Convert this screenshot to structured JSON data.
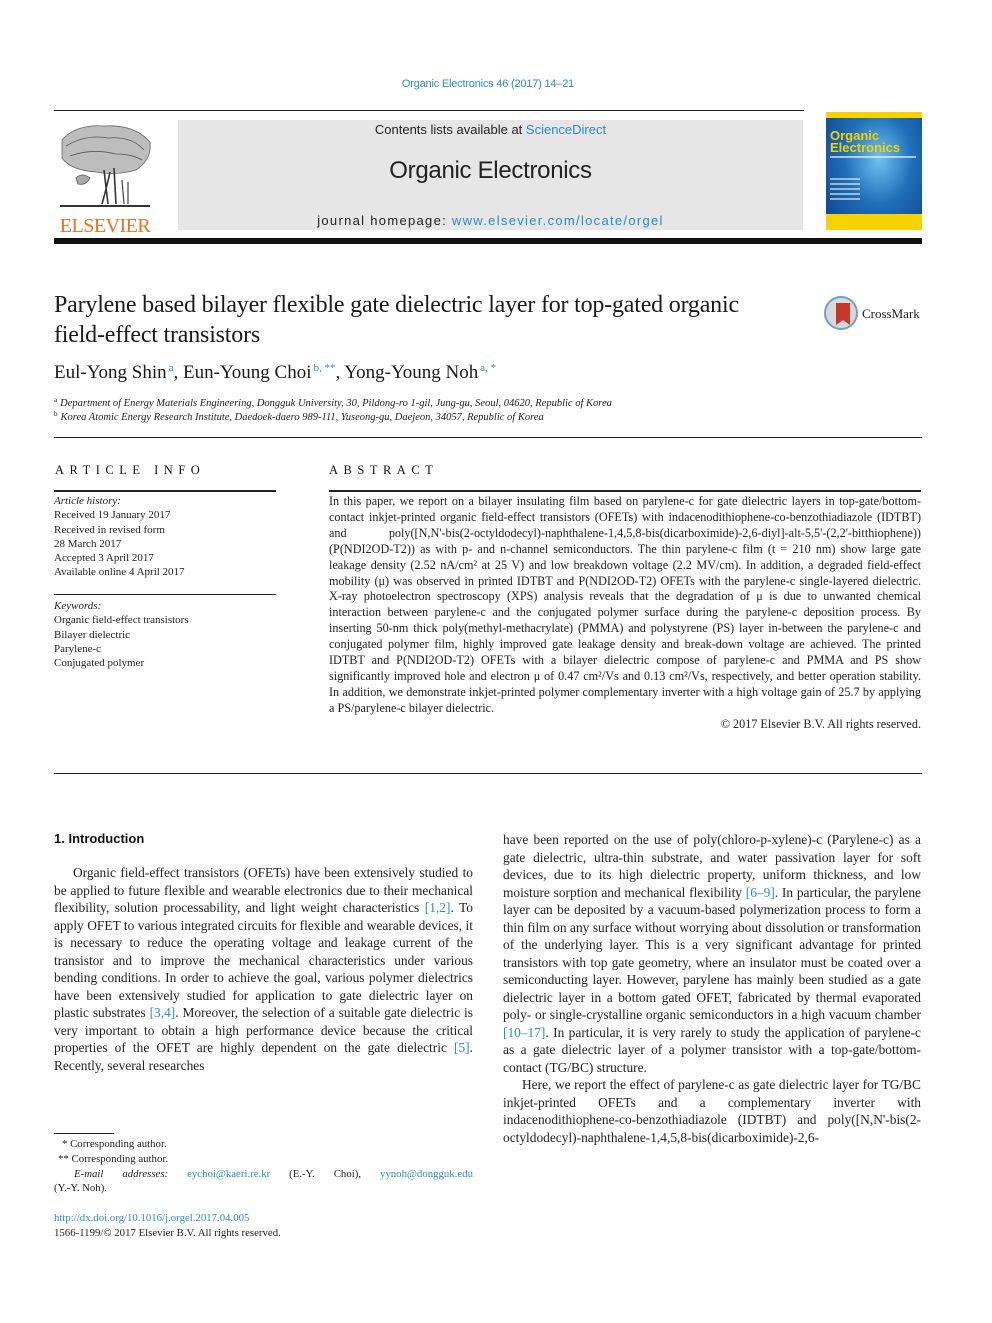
{
  "header": {
    "journal_reference": "Organic Electronics 46 (2017) 14–21",
    "contents_prefix": "Contents lists available at ",
    "contents_link": "ScienceDirect",
    "journal_title": "Organic Electronics",
    "homepage_prefix": "journal homepage: ",
    "homepage_link": "www.elsevier.com/locate/orgel",
    "publisher_logo_text": "ELSEVIER",
    "cover_title_line1": "Organic",
    "cover_title_line2": "Electronics",
    "crossmark_label": "CrossMark",
    "colors": {
      "link": "#2a8cc4",
      "elsevier_orange": "#e9711c",
      "header_box": "#e6e6e6"
    }
  },
  "article": {
    "title": "Parylene based bilayer flexible gate dielectric layer for top-gated organic field-effect transistors",
    "authors": [
      {
        "name": "Eul-Yong Shin",
        "marks": "a"
      },
      {
        "name": "Eun-Young Choi",
        "marks": "b, **"
      },
      {
        "name": "Yong-Young Noh",
        "marks": "a, *"
      }
    ],
    "affiliations": [
      {
        "mark": "a",
        "text": "Department of Energy Materials Engineering, Dongguk University, 30, Pildong-ro 1-gil, Jung-gu, Seoul, 04620, Republic of Korea"
      },
      {
        "mark": "b",
        "text": "Korea Atomic Energy Research Institute, Daedoek-daero 989-111, Yuseong-gu, Daejeon, 34057, Republic of Korea"
      }
    ]
  },
  "article_info": {
    "heading": "ARTICLE INFO",
    "history_label": "Article history:",
    "history": [
      "Received 19 January 2017",
      "Received in revised form",
      "28 March 2017",
      "Accepted 3 April 2017",
      "Available online 4 April 2017"
    ],
    "keywords_label": "Keywords:",
    "keywords": [
      "Organic field-effect transistors",
      "Bilayer dielectric",
      "Parylene-c",
      "Conjugated polymer"
    ]
  },
  "abstract": {
    "heading": "ABSTRACT",
    "text": "In this paper, we report on a bilayer insulating film based on parylene-c for gate dielectric layers in top-gate/bottom-contact inkjet-printed organic field-effect transistors (OFETs) with indacenodithiophene-co-benzothiadiazole (IDTBT) and poly([N,N'-bis(2-octyldodecyl)-naphthalene-1,4,5,8-bis(dicarboximide)-2,6-diyl]-alt-5,5'-(2,2'-bitthiophene)) (P(NDI2OD-T2)) as with p- and n-channel semiconductors. The thin parylene-c film (t = 210 nm) show large gate leakage density (2.52 nA/cm² at 25 V) and low breakdown voltage (2.2 MV/cm). In addition, a degraded field-effect mobility (μ) was observed in printed IDTBT and P(NDI2OD-T2) OFETs with the parylene-c single-layered dielectric. X-ray photoelectron spectroscopy (XPS) analysis reveals that the degradation of μ is due to unwanted chemical interaction between parylene-c and the conjugated polymer surface during the parylene-c deposition process. By inserting 50-nm thick poly(methyl-methacrylate) (PMMA) and polystyrene (PS) layer in-between the parylene-c and conjugated polymer film, highly improved gate leakage density and break-down voltage are achieved. The printed IDTBT and P(NDI2OD-T2) OFETs with a bilayer dielectric compose of parylene-c and PMMA and PS show significantly improved hole and electron μ of 0.47 cm²/Vs and 0.13 cm²/Vs, respectively, and better operation stability. In addition, we demonstrate inkjet-printed polymer complementary inverter with a high voltage gain of 25.7 by applying a PS/parylene-c bilayer dielectric.",
    "copyright": "© 2017 Elsevier B.V. All rights reserved."
  },
  "introduction": {
    "heading": "1.  Introduction",
    "left_p1_a": "Organic field-effect transistors (OFETs) have been extensively studied to be applied to future flexible and wearable electronics due to their mechanical flexibility, solution processability, and light weight characteristics ",
    "ref1": "[1,2]",
    "left_p1_b": ". To apply OFET to various integrated circuits for flexible and wearable devices, it is necessary to reduce the operating voltage and leakage current of the transistor and to improve the mechanical characteristics under various bending conditions. In order to achieve the goal, various polymer dielectrics have been extensively studied for application to gate dielectric layer on plastic substrates ",
    "ref2": "[3,4]",
    "left_p1_c": ". Moreover, the selection of a suitable gate dielectric is very important to obtain a high performance device because the critical properties of the OFET are highly dependent on the gate dielectric ",
    "ref3": "[5]",
    "left_p1_d": ". Recently, several researches",
    "right_p1_a": "have been reported on the use of poly(chloro-p-xylene)-c (Parylene-c) as a gate dielectric, ultra-thin substrate, and water passivation layer for soft devices, due to its high dielectric property, uniform thickness, and low moisture sorption and mechanical flexibility ",
    "ref4": "[6–9]",
    "right_p1_b": ". In particular, the parylene layer can be deposited by a vacuum-based polymerization process to form a thin film on any surface without worrying about dissolution or transformation of the underlying layer. This is a very significant advantage for printed transistors with top gate geometry, where an insulator must be coated over a semiconducting layer. However, parylene has mainly been studied as a gate dielectric layer in a bottom gated OFET, fabricated by thermal evaporated poly- or single-crystalline organic semiconductors in a high vacuum chamber ",
    "ref5": "[10–17]",
    "right_p1_c": ". In particular, it is very rarely to study the application of parylene-c as a gate dielectric layer of a polymer transistor with a top-gate/bottom-contact (TG/BC) structure.",
    "right_p2": "Here, we report the effect of parylene-c as gate dielectric layer for TG/BC inkjet-printed OFETs and a complementary inverter with indacenodithiophene-co-benzothiadiazole (IDTBT) and poly([N,N'-bis(2-octyldodecyl)-naphthalene-1,4,5,8-bis(dicarboximide)-2,6-"
  },
  "footnotes": {
    "fn1": "* Corresponding author.",
    "fn2": "** Corresponding author.",
    "email_label": "E-mail addresses:",
    "email1": "eychoi@kaeri.re.kr",
    "email1_who": " (E.-Y. Choi), ",
    "email2": "yynoh@dongguk.edu",
    "email2_who": " (Y.-Y. Noh).",
    "doi_link": "http://dx.doi.org/10.1016/j.orgel.2017.04.005",
    "issn_line": "1566-1199/© 2017 Elsevier B.V. All rights reserved."
  }
}
